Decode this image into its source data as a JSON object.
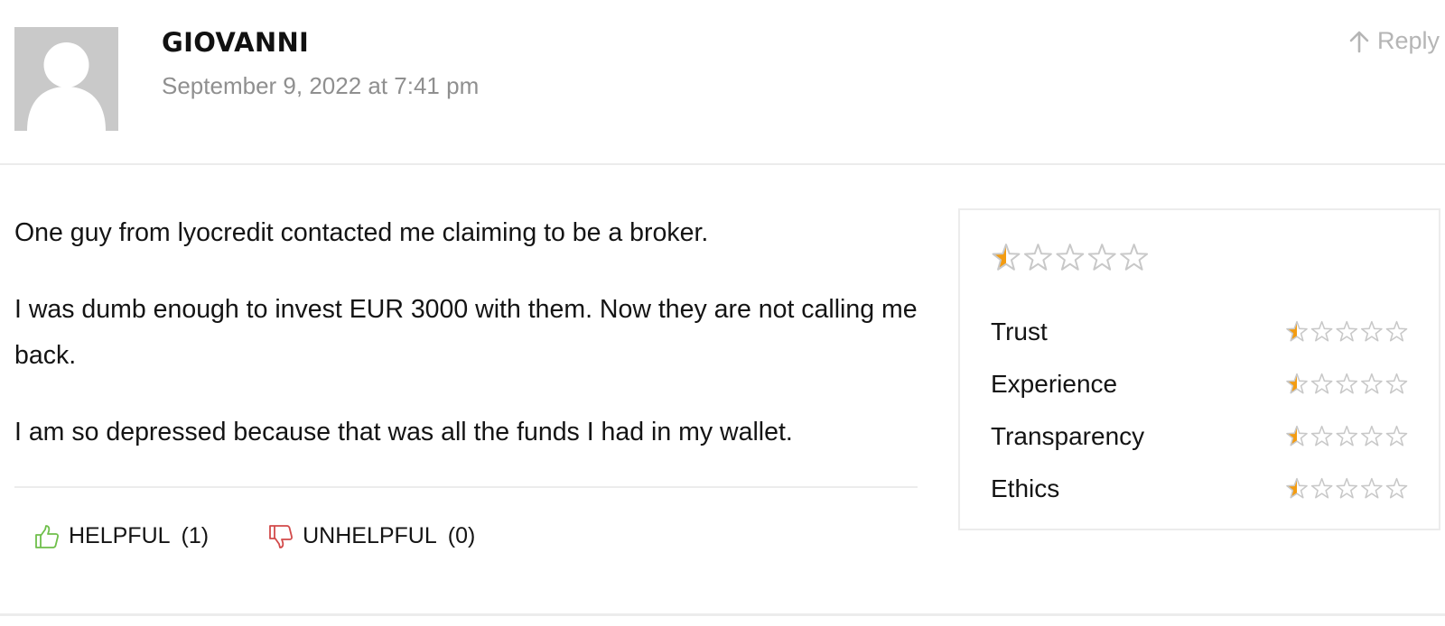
{
  "comment": {
    "author": "GIOVANNI",
    "date": "September 9, 2022 at 7:41 pm",
    "reply_label": "Reply",
    "reply_icon": "arrow-up-icon",
    "avatar_icon": "default-user-avatar",
    "paragraphs": [
      "One guy from lyocredit contacted me claiming to be a broker.",
      "I was dumb enough to invest EUR 3000 with them. Now they are not calling me back.",
      "I am so depressed because that was all the funds I had in my wallet."
    ]
  },
  "votes": {
    "helpful": {
      "label": "HELPFUL",
      "count": "(1)",
      "icon": "thumbs-up-icon",
      "color": "#6fbf4a"
    },
    "unhelpful": {
      "label": "UNHELPFUL",
      "count": "(0)",
      "icon": "thumbs-down-icon",
      "color": "#d24a4a"
    }
  },
  "rating": {
    "max_stars": 5,
    "star_fill_color": "#f39c12",
    "star_empty_color": "#c8c8c8",
    "overall": 0.5,
    "criteria": [
      {
        "label": "Trust",
        "value": 0.5
      },
      {
        "label": "Experience",
        "value": 0.5
      },
      {
        "label": "Transparency",
        "value": 0.5
      },
      {
        "label": "Ethics",
        "value": 0.5
      }
    ]
  }
}
